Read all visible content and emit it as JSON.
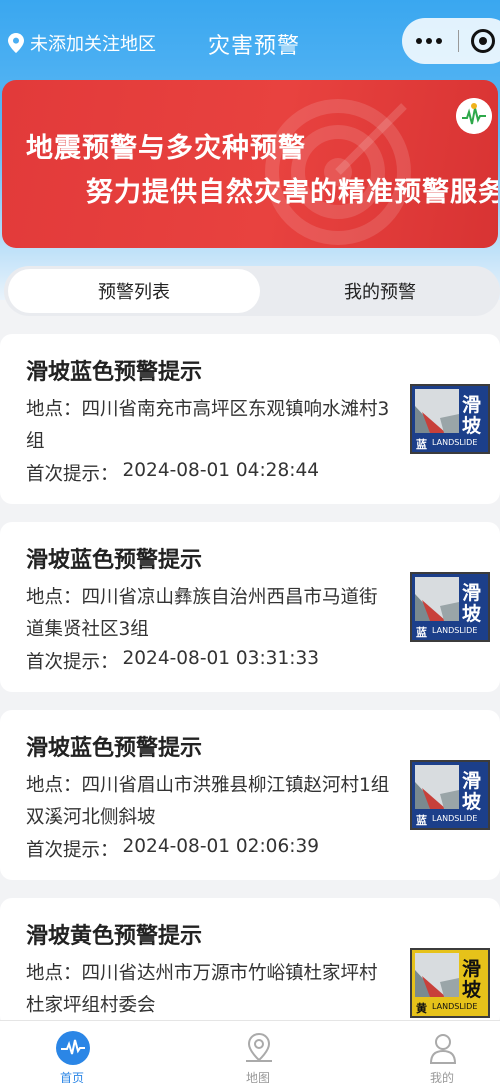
{
  "header": {
    "location_text": "未添加关注地区",
    "title": "灾害预警"
  },
  "banner": {
    "line1": "地震预警与多灾种预警",
    "line2": "努力提供自然灾害的精准预警服务"
  },
  "tabs": [
    {
      "label": "预警列表",
      "active": true
    },
    {
      "label": "我的预警",
      "active": false
    }
  ],
  "alerts": [
    {
      "title": "滑坡蓝色预警提示",
      "location_label": "地点：",
      "location": "四川省南充市高坪区东观镇响水滩村3组",
      "time_label": "首次提示：",
      "time": "2024-08-01 04:28:44",
      "sign_level": "蓝",
      "sign_type": "滑坡",
      "sign_en": "LANDSLIDE",
      "sign_color": "#1c3f8a"
    },
    {
      "title": "滑坡蓝色预警提示",
      "location_label": "地点：",
      "location": "四川省凉山彝族自治州西昌市马道街道集贤社区3组",
      "time_label": "首次提示：",
      "time": "2024-08-01 03:31:33",
      "sign_level": "蓝",
      "sign_type": "滑坡",
      "sign_en": "LANDSLIDE",
      "sign_color": "#1c3f8a"
    },
    {
      "title": "滑坡蓝色预警提示",
      "location_label": "地点：",
      "location": "四川省眉山市洪雅县柳江镇赵河村1组双溪河北侧斜坡",
      "time_label": "首次提示：",
      "time": "2024-08-01 02:06:39",
      "sign_level": "蓝",
      "sign_type": "滑坡",
      "sign_en": "LANDSLIDE",
      "sign_color": "#1c3f8a"
    },
    {
      "title": "滑坡黄色预警提示",
      "location_label": "地点：",
      "location": "四川省达州市万源市竹峪镇杜家坪村杜家坪组村委会",
      "time_label": "",
      "time": "",
      "sign_level": "黄",
      "sign_type": "滑坡",
      "sign_en": "LANDSLIDE",
      "sign_color": "#e6c21a"
    }
  ],
  "nav": [
    {
      "label": "首页",
      "icon": "home-wave-icon",
      "active": true
    },
    {
      "label": "地图",
      "icon": "map-pin-icon",
      "active": false
    },
    {
      "label": "我的",
      "icon": "user-icon",
      "active": false
    }
  ],
  "colors": {
    "accent": "#2b86e6",
    "banner_red": "#e23a3a",
    "blue_warning": "#1c3f8a",
    "yellow_warning": "#e6c21a"
  }
}
